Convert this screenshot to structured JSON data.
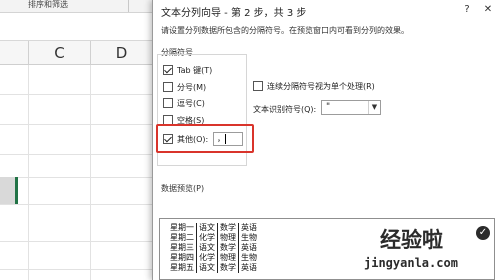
{
  "ribbon": {
    "group_label": "排序和筛选"
  },
  "sheet": {
    "col_c": "C",
    "col_d": "D"
  },
  "dialog": {
    "title": "文本分列向导 - 第 2 步，共 3 步",
    "help": "?",
    "close": "✕",
    "instruction": "请设置分列数据所包含的分隔符号。在预览窗口内可看到分列的效果。"
  },
  "delimiters": {
    "group_label": "分隔符号",
    "items": [
      {
        "label": "Tab 键(T)",
        "checked": true
      },
      {
        "label": "分号(M)",
        "checked": false
      },
      {
        "label": "逗号(C)",
        "checked": false
      },
      {
        "label": "空格(S)",
        "checked": false
      },
      {
        "label": "其他(O):",
        "checked": true
      }
    ],
    "other_value": "，"
  },
  "options": {
    "consecutive_label": "连续分隔符号视为单个处理(R)",
    "consecutive_checked": false,
    "qualifier_label": "文本识别符号(Q):",
    "qualifier_value": "\""
  },
  "preview": {
    "label": "数据预览(P)",
    "rows": [
      [
        "星期一",
        "语文",
        "数学",
        "英语"
      ],
      [
        "星期二",
        "化学",
        "物理",
        "生物"
      ],
      [
        "星期三",
        "语文",
        "数学",
        "英语"
      ],
      [
        "星期四",
        "化学",
        "物理",
        "生物"
      ],
      [
        "星期五",
        "语文",
        "数学",
        "英语"
      ]
    ]
  },
  "watermark": {
    "title": "经验啦",
    "url": "jingyanla.com",
    "check": "✓"
  },
  "colors": {
    "highlight": "#d9342b",
    "excel_green": "#217346"
  }
}
